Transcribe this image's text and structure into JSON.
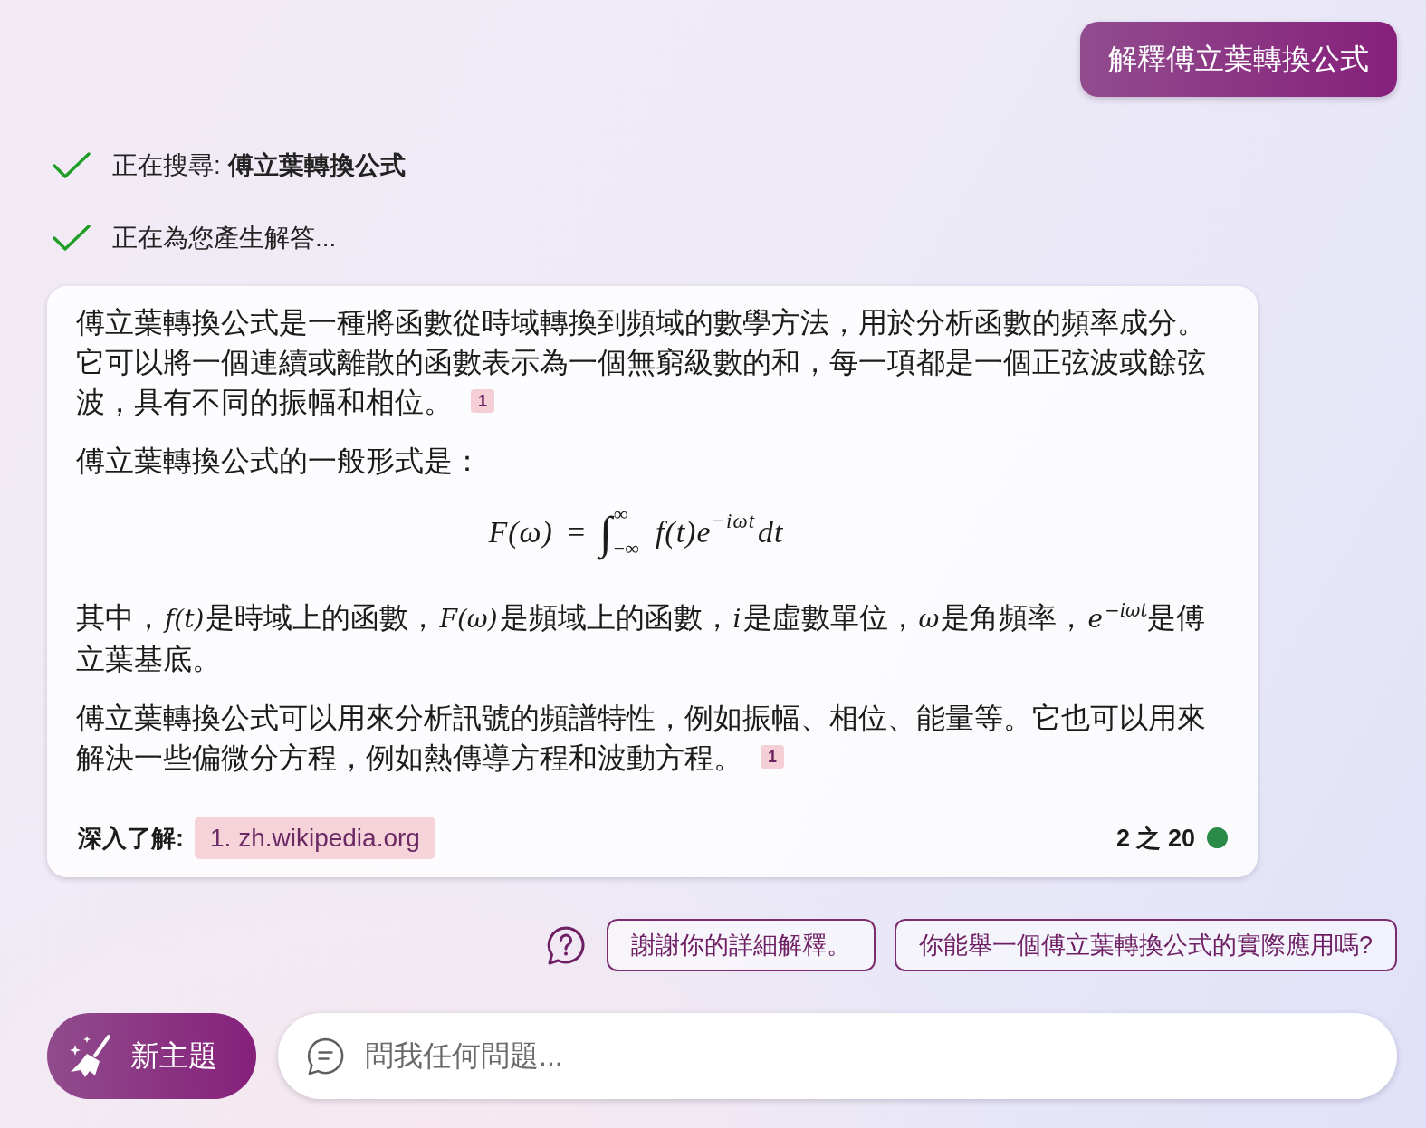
{
  "user_message": "解釋傅立葉轉換公式",
  "status": [
    {
      "text": "正在搜尋: **傅立葉轉換公式**",
      "done": true
    },
    {
      "text": "正在為您產生解答...",
      "done": true
    }
  ],
  "answer": {
    "blocks": [
      {
        "kind": "paragraph",
        "segments": [
          {
            "kind": "text",
            "text": "傅立葉轉換公式是一種將函數從時域轉換到頻域的數學方法，用於分析函數的頻率成分。它可以將一個連續或離散的函數表示為一個無窮級數的和，每一項都是一個正弦波或餘弦波，具有不同的振幅和相位。"
          }
        ],
        "citation": "1"
      },
      {
        "kind": "paragraph",
        "segments": [
          {
            "kind": "text",
            "text": "傅立葉轉換公式的一般形式是："
          }
        ]
      },
      {
        "kind": "formula",
        "lhs": "F(ω)",
        "relation": "=",
        "operator": "∫",
        "lower_limit": "−∞",
        "upper_limit": "∞",
        "integrand": "f(t)e",
        "exponent": "−iωt",
        "differential": "dt"
      },
      {
        "kind": "paragraph",
        "segments": [
          {
            "kind": "text",
            "text": "其中，"
          },
          {
            "kind": "math",
            "text": "f(t)"
          },
          {
            "kind": "text",
            "text": "是時域上的函數，"
          },
          {
            "kind": "math",
            "text": "F(ω)"
          },
          {
            "kind": "text",
            "text": "是頻域上的函數，"
          },
          {
            "kind": "math",
            "text": "i"
          },
          {
            "kind": "text",
            "text": "是虛數單位，"
          },
          {
            "kind": "math",
            "text": "ω"
          },
          {
            "kind": "text",
            "text": "是角頻率，"
          },
          {
            "kind": "math",
            "text": "e"
          },
          {
            "kind": "exponent",
            "text": "−iωt"
          },
          {
            "kind": "text",
            "text": "是傅立葉基底。"
          }
        ]
      },
      {
        "kind": "paragraph",
        "segments": [
          {
            "kind": "text",
            "text": "傅立葉轉換公式可以用來分析訊號的頻譜特性，例如振幅、相位、能量等。它也可以用來解決一些偏微分方程，例如熱傳導方程和波動方程。"
          }
        ],
        "citation": "1"
      }
    ],
    "footer": {
      "label": "深入了解:",
      "sources": [
        "1. zh.wikipedia.org"
      ],
      "counter": "2 之 20"
    }
  },
  "suggestions": [
    "謝謝你的詳細解釋。",
    "你能舉一個傅立葉轉換公式的實際應用嗎?"
  ],
  "new_topic_button": "新主題",
  "input": {
    "placeholder": "問我任何問題..."
  }
}
